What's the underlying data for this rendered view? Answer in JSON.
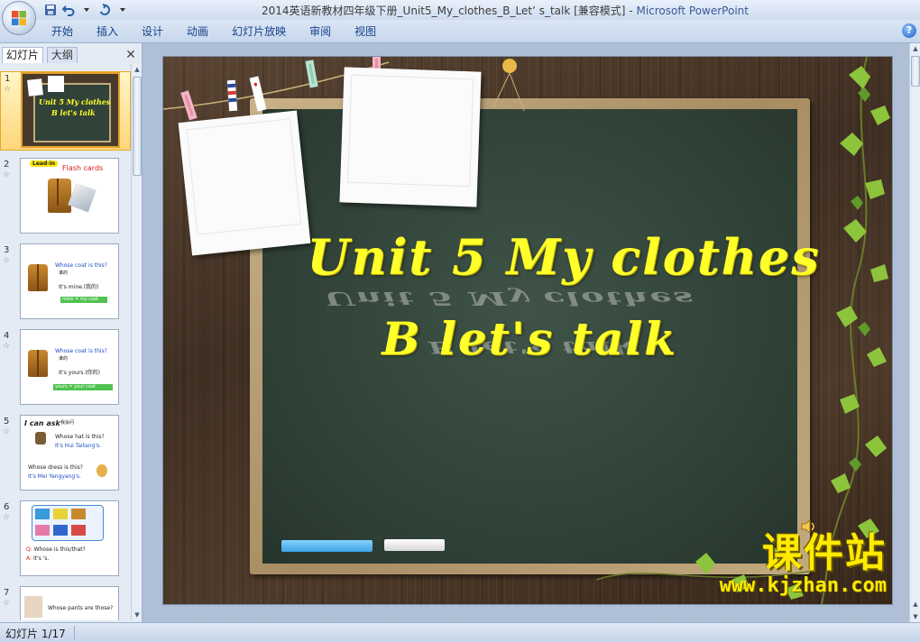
{
  "window": {
    "title": "2014英语新教材四年级下册_Unit5_My_clothes_B_Let’ s_talk [兼容模式]",
    "title_separator": " - ",
    "app_name": "Microsoft PowerPoint"
  },
  "ribbon": {
    "tabs": [
      "开始",
      "插入",
      "设计",
      "动画",
      "幻灯片放映",
      "审阅",
      "视图"
    ],
    "help": "?"
  },
  "left_panel": {
    "tabs": [
      "幻灯片",
      "大纲"
    ],
    "close": "✕",
    "slides": [
      {
        "num": "1",
        "label_1": "Unit 5 My clothes",
        "label_2": "B let's talk"
      },
      {
        "num": "2",
        "badge": "Lead-in",
        "heading": "Flash cards"
      },
      {
        "num": "3",
        "q": "Whose  coat  is this?",
        "cn": "谁的",
        "a": "It's  mine.(我的)",
        "bar": "mine = my coat"
      },
      {
        "num": "4",
        "q": "Whose  coat  is this?",
        "cn": "谁的",
        "a": "It's  yours.(你的)",
        "bar": "yours = your coat"
      },
      {
        "num": "5",
        "heading": "I can ask",
        "cn": "我会问",
        "q1": "Whose  hat  is this?",
        "a1": "It's Hui Taitang's.",
        "q2": "Whose  dress is this?",
        "a2": "It's Mei Yangyang's."
      },
      {
        "num": "6",
        "q": "Whose       is this/that?",
        "q_prefix": "Q:",
        "a": "It's            's.",
        "a_prefix": "A:"
      },
      {
        "num": "7",
        "q": "Whose  pants  are those?"
      }
    ]
  },
  "slide": {
    "title_line_1": "Unit 5 My clothes",
    "title_line_2": "B let's talk",
    "watermark_cn": "课件站",
    "watermark_url": "www.kjzhan.com"
  },
  "status": {
    "slide_counter": "幻灯片 1/17"
  },
  "colors": {
    "title_yellow": "#ffff2a",
    "board_green": "#314338",
    "ribbon_text": "#15428b"
  }
}
